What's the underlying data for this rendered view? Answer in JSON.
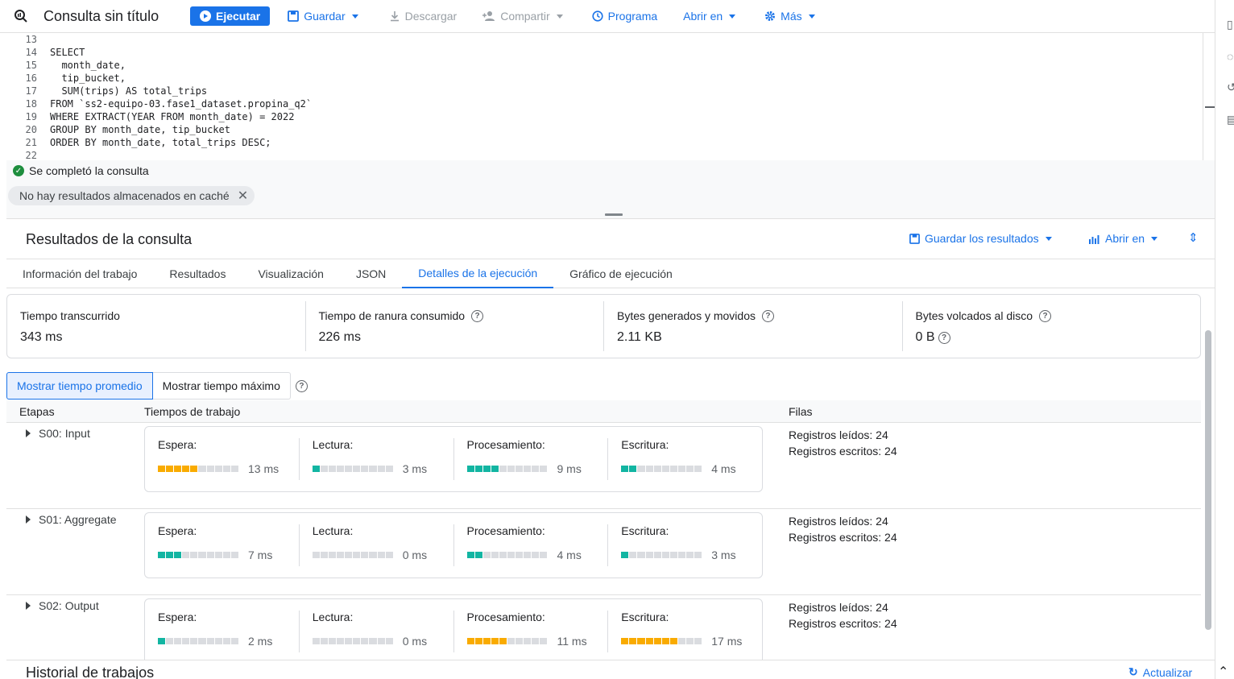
{
  "toolbar": {
    "title": "Consulta sin título",
    "run": "Ejecutar",
    "save": "Guardar",
    "download": "Descargar",
    "share": "Compartir",
    "schedule": "Programa",
    "open_in": "Abrir en",
    "more": "Más"
  },
  "editor": {
    "lines": [
      {
        "n": "13",
        "text": ""
      },
      {
        "n": "14",
        "text": "SELECT"
      },
      {
        "n": "15",
        "text": "  month_date,"
      },
      {
        "n": "16",
        "text": "  tip_bucket,"
      },
      {
        "n": "17",
        "text": "  SUM(trips) AS total_trips"
      },
      {
        "n": "18",
        "text": "FROM `ss2-equipo-03.fase1_dataset.propina_q2`"
      },
      {
        "n": "19",
        "text": "WHERE EXTRACT(YEAR FROM month_date) = 2022"
      },
      {
        "n": "20",
        "text": "GROUP BY month_date, tip_bucket"
      },
      {
        "n": "21",
        "text": "ORDER BY month_date, total_trips DESC;"
      },
      {
        "n": "22",
        "text": ""
      }
    ]
  },
  "status": {
    "message": "Se completó la consulta",
    "chip": "No hay resultados almacenados en caché"
  },
  "results": {
    "title": "Resultados de la consulta",
    "save_results": "Guardar los resultados",
    "open_in": "Abrir en",
    "tabs": [
      "Información del trabajo",
      "Resultados",
      "Visualización",
      "JSON",
      "Detalles de la ejecución",
      "Gráfico de ejecución"
    ],
    "active_tab": "Detalles de la ejecución",
    "metrics": [
      {
        "label": "Tiempo transcurrido",
        "value": "343 ms",
        "help": false
      },
      {
        "label": "Tiempo de ranura consumido",
        "value": "226 ms",
        "help": true
      },
      {
        "label": "Bytes generados y movidos",
        "value": "2.11 KB",
        "help": true
      },
      {
        "label": "Bytes volcados al disco",
        "value": "0 B",
        "help": true
      }
    ],
    "toggle": {
      "avg": "Mostrar tiempo promedio",
      "max": "Mostrar tiempo máximo"
    },
    "headers": {
      "stages": "Etapas",
      "times": "Tiempos de trabajo",
      "rows": "Filas"
    },
    "timing_labels": [
      "Espera:",
      "Lectura:",
      "Procesamiento:",
      "Escritura:"
    ],
    "stages": [
      {
        "name": "S00: Input",
        "times": [
          {
            "value": "13 ms",
            "filled": 5,
            "color": "#f9ab00"
          },
          {
            "value": "3 ms",
            "filled": 1,
            "color": "#12b5a2"
          },
          {
            "value": "9 ms",
            "filled": 4,
            "color": "#12b5a2"
          },
          {
            "value": "4 ms",
            "filled": 2,
            "color": "#12b5a2"
          }
        ],
        "read": "Registros leídos: 24",
        "written": "Registros escritos: 24"
      },
      {
        "name": "S01: Aggregate",
        "times": [
          {
            "value": "7 ms",
            "filled": 3,
            "color": "#12b5a2"
          },
          {
            "value": "0 ms",
            "filled": 0,
            "color": "#12b5a2"
          },
          {
            "value": "4 ms",
            "filled": 2,
            "color": "#12b5a2"
          },
          {
            "value": "3 ms",
            "filled": 1,
            "color": "#12b5a2"
          }
        ],
        "read": "Registros leídos: 24",
        "written": "Registros escritos: 24"
      },
      {
        "name": "S02: Output",
        "times": [
          {
            "value": "2 ms",
            "filled": 1,
            "color": "#12b5a2"
          },
          {
            "value": "0 ms",
            "filled": 0,
            "color": "#12b5a2"
          },
          {
            "value": "11 ms",
            "filled": 5,
            "color": "#f9ab00"
          },
          {
            "value": "17 ms",
            "filled": 7,
            "color": "#f9ab00"
          }
        ],
        "read": "Registros leídos: 24",
        "written": "Registros escritos: 24"
      }
    ]
  },
  "history": {
    "title": "Historial de trabajos",
    "refresh": "Actualizar"
  }
}
